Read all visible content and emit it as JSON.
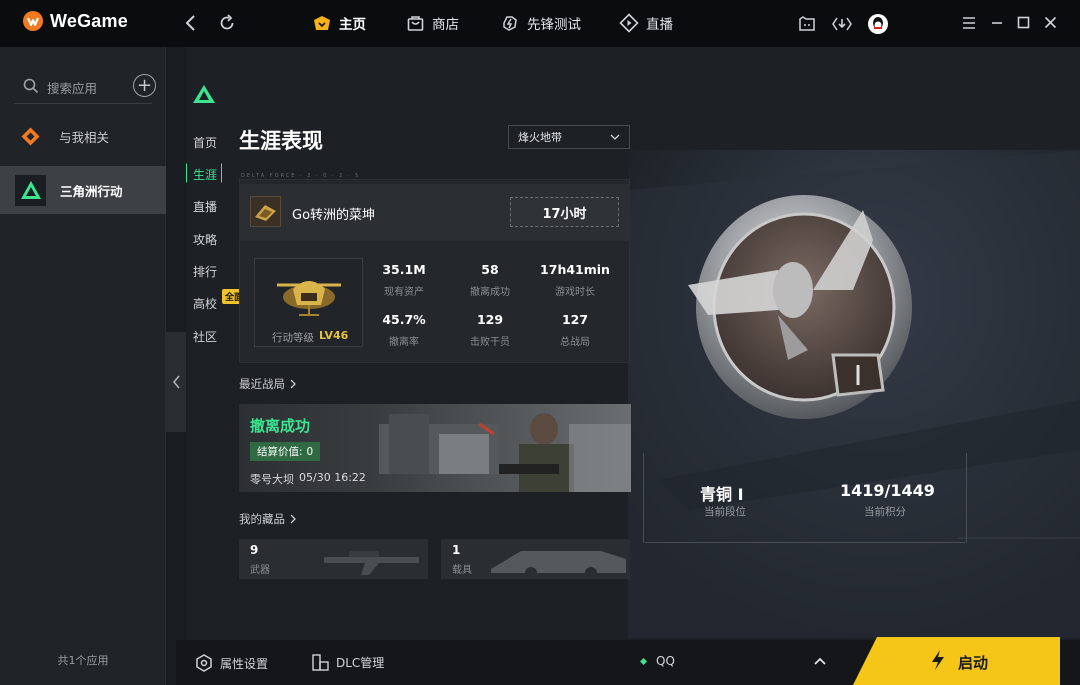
{
  "app": {
    "name": "WeGame"
  },
  "nav": {
    "tabs": [
      {
        "label": "主页",
        "active": true
      },
      {
        "label": "商店"
      },
      {
        "label": "先锋测试"
      },
      {
        "label": "直播"
      }
    ]
  },
  "sidebar": {
    "search_placeholder": "搜索应用",
    "items": [
      {
        "label": "与我相关"
      },
      {
        "label": "三角洲行动",
        "active": true
      }
    ],
    "footer": "共1个应用"
  },
  "game": {
    "subnav": [
      "首页",
      "生涯",
      "直播",
      "攻略",
      "排行",
      "高校",
      "社区"
    ],
    "active_subnav": "生涯",
    "badge": "全面更新"
  },
  "career": {
    "title": "生涯表现",
    "mode": "烽火地带",
    "strip_text": "DELTA FORCE · 2 · 0 · 2 · 5",
    "player_name": "Go转洲的菜坤",
    "play_time": "17小时",
    "level_label": "行动等级",
    "level_value": "LV46",
    "stats": [
      {
        "value": "35.1M",
        "label": "现有资产"
      },
      {
        "value": "58",
        "label": "撤离成功"
      },
      {
        "value": "17h41min",
        "label": "游戏时长"
      },
      {
        "value": "45.7%",
        "label": "撤离率"
      },
      {
        "value": "129",
        "label": "击败干员"
      },
      {
        "value": "127",
        "label": "总战局"
      }
    ],
    "recent_title": "最近战局",
    "match": {
      "status": "撤离成功",
      "settle_label": "结算价值:",
      "settle_value": "0",
      "map": "零号大坝",
      "time": "05/30 16:22"
    },
    "collection_title": "我的藏品",
    "collection": [
      {
        "count": "9",
        "label": "武器"
      },
      {
        "count": "1",
        "label": "载具"
      }
    ],
    "rank": {
      "name": "青铜 I",
      "name_label": "当前段位",
      "score": "1419/1449",
      "score_label": "当前积分"
    }
  },
  "bottom": {
    "props": "属性设置",
    "dlc": "DLC管理",
    "account": "QQ",
    "launch": "启动"
  },
  "colors": {
    "accent_green": "#3ce590",
    "launch_yellow": "#f5c518",
    "level_gold": "#e4c33a"
  }
}
